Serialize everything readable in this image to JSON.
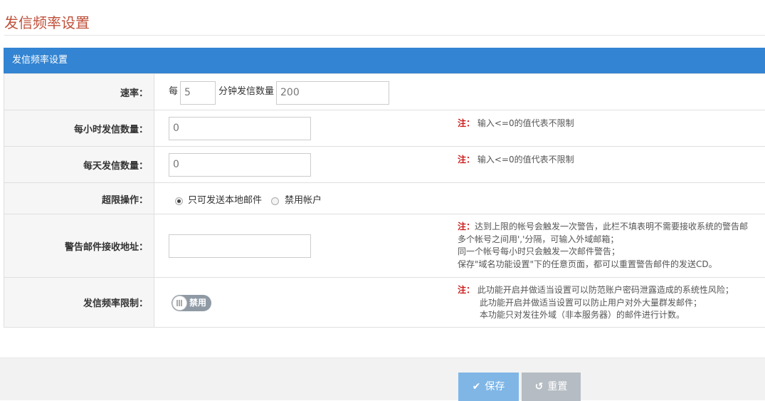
{
  "page_title": "发信频率设置",
  "panel": {
    "title": "发信频率设置"
  },
  "rate": {
    "label": "速率：",
    "prefix": "每",
    "minutes_value": "5",
    "middle_text": "分钟发信数量",
    "count_value": "200"
  },
  "hourly": {
    "label": "每小时发信数量：",
    "value": "0",
    "note_mark": "注：",
    "note_text": "输入<=0的值代表不限制"
  },
  "daily": {
    "label": "每天发信数量：",
    "value": "0",
    "note_mark": "注：",
    "note_text": "输入<=0的值代表不限制"
  },
  "overlimit": {
    "label": "超限操作：",
    "option1": "只可发送本地邮件",
    "option2": "禁用帐户",
    "selected": "option1"
  },
  "warn_email": {
    "label": "警告邮件接收地址：",
    "value": "",
    "note_mark": "注：",
    "note_lines": [
      "达到上限的帐号会触发一次警告，此栏不填表明不需要接收系统的警告邮",
      "多个帐号之间用','分隔，可输入外域邮箱；",
      "同一个帐号每小时只会触发一次邮件警告；",
      "保存\"域名功能设置\"下的任意页面，都可以重置警告邮件的发送CD。"
    ]
  },
  "freq_limit": {
    "label": "发信频率限制：",
    "toggle_label": "禁用",
    "enabled": false,
    "note_mark": "注：",
    "note_lines": [
      "此功能开启并做适当设置可以防范账户密码泄露造成的系统性风险；",
      "此功能开启并做适当设置可以防止用户对外大量群发邮件；",
      "本功能只对发往外域（非本服务器）的邮件进行计数。"
    ]
  },
  "buttons": {
    "save": "保存",
    "reset": "重置"
  },
  "icons": {
    "save": "check-icon",
    "reset": "undo-icon"
  },
  "colors": {
    "header": "#3384d2",
    "title": "#c0503a",
    "note_mark": "#cc1b1b"
  }
}
